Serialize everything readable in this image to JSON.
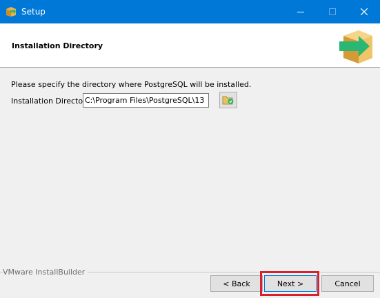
{
  "window": {
    "title": "Setup",
    "icons": {
      "app": "box-setup-icon",
      "minimize": "minimize-icon",
      "maximize": "maximize-icon",
      "close": "close-icon"
    }
  },
  "header": {
    "title": "Installation Directory",
    "logo_icon": "box-arrow-install-icon"
  },
  "main": {
    "description": "Please specify the directory where PostgreSQL will be installed.",
    "directory_label": "Installation Directory",
    "directory_value": "C:\\Program Files\\PostgreSQL\\13",
    "browse_icon": "folder-browse-icon"
  },
  "footer": {
    "brand": "VMware InstallBuilder",
    "back_label": "< Back",
    "next_label": "Next >",
    "cancel_label": "Cancel"
  },
  "colors": {
    "titlebar": "#0078d7",
    "highlight": "#d9202b",
    "logo_box": "#e8b24a",
    "logo_arrow": "#2bb673"
  }
}
